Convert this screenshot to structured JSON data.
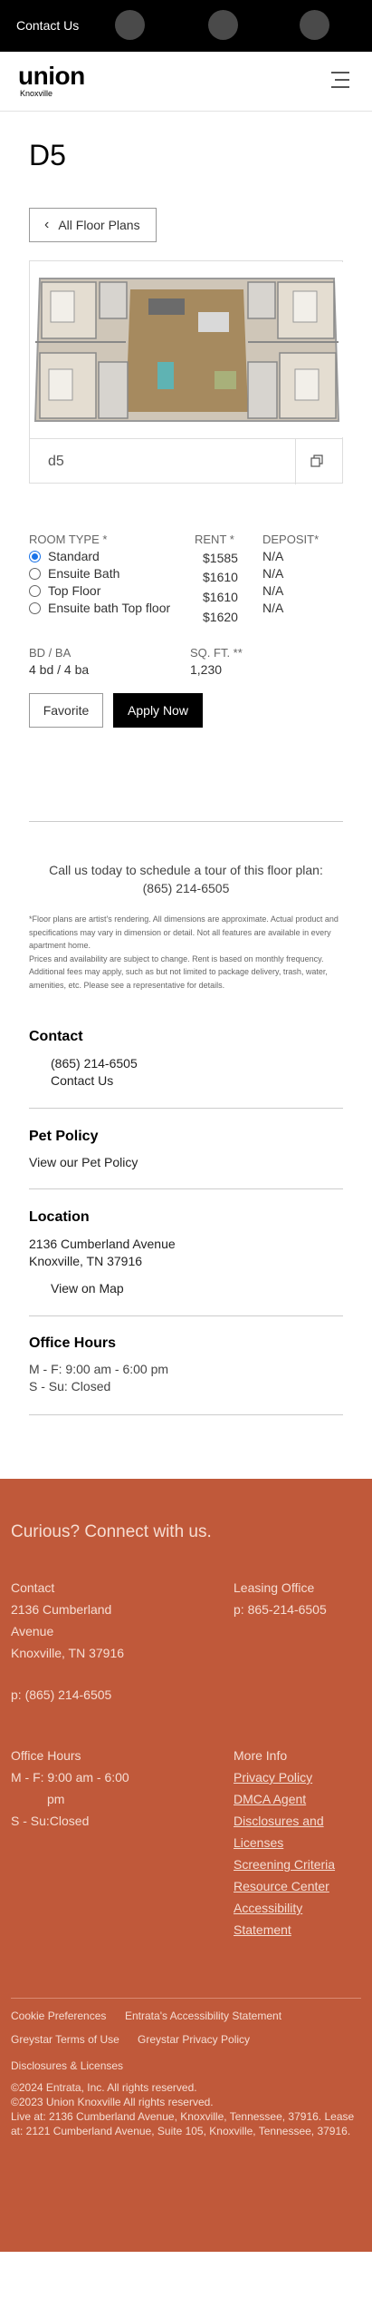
{
  "topbar": {
    "contact_label": "Contact Us"
  },
  "brand": {
    "logo": "union",
    "sub": "Knoxville"
  },
  "plan": {
    "title": "D5",
    "back_label": "All Floor Plans",
    "caption": "d5"
  },
  "details": {
    "headers": {
      "room_type": "ROOM TYPE *",
      "rent": "RENT *",
      "deposit": "DEPOSIT*"
    },
    "rows": [
      {
        "room_type": "Standard",
        "rent": "$1585",
        "deposit": "N/A",
        "selected": true
      },
      {
        "room_type": "Ensuite Bath",
        "rent": "$1610",
        "deposit": "N/A",
        "selected": false
      },
      {
        "room_type": "Top Floor",
        "rent": "$1610",
        "deposit": "N/A",
        "selected": false
      },
      {
        "room_type": "Ensuite bath Top floor",
        "rent": "$1620",
        "deposit": "N/A",
        "selected": false
      }
    ],
    "bdba_label": "BD / BA",
    "bdba_value": "4 bd / 4 ba",
    "sqft_label": "SQ. FT. **",
    "sqft_value": "1,230"
  },
  "actions": {
    "favorite": "Favorite",
    "apply": "Apply Now"
  },
  "schedule": {
    "line1": "Call us today to schedule a tour of this floor plan:",
    "phone": "(865) 214-6505"
  },
  "disclaimer": {
    "p1": "*Floor plans are artist's rendering. All dimensions are approximate. Actual product and specifications may vary in dimension or detail. Not all features are available in every apartment home.",
    "p2": "Prices and availability are subject to change. Rent is based on monthly frequency. Additional fees may apply, such as but not limited to package delivery, trash, water, amenities, etc. Please see a representative for details."
  },
  "contact": {
    "title": "Contact",
    "phone": "(865) 214-6505",
    "link": "Contact Us"
  },
  "pet": {
    "title": "Pet Policy",
    "link": "View our Pet Policy"
  },
  "location": {
    "title": "Location",
    "street": "2136 Cumberland Avenue",
    "city": "Knoxville, TN 37916",
    "map_link": "View on Map"
  },
  "hours": {
    "title": "Office Hours",
    "weekday": "M - F:  9:00 am - 6:00 pm",
    "weekend": "S - Su:  Closed"
  },
  "footer": {
    "headline": "Curious? Connect with us.",
    "contact_title": "Contact",
    "contact_street1": "2136 Cumberland",
    "contact_street2": "Avenue",
    "contact_city": "Knoxville, TN 37916",
    "contact_phone": "p: (865) 214-6505",
    "leasing_title": "Leasing Office",
    "leasing_phone": "p: 865-214-6505",
    "hours_title": "Office Hours",
    "hours_weekday1": "M - F: 9:00 am - 6:00",
    "hours_weekday2": "pm",
    "hours_weekend": "S - Su:Closed",
    "more_title": "More Info",
    "links": [
      "Privacy Policy",
      "DMCA Agent",
      "Disclosures and",
      "Licenses",
      "Screening Criteria",
      "Resource Center",
      "Accessibility",
      "Statement"
    ],
    "cookie": "Cookie Preferences",
    "entrata_access": "Entrata's Accessibility Statement",
    "greystar_terms": "Greystar Terms of Use",
    "greystar_privacy": "Greystar Privacy Policy",
    "disclosures": "Disclosures & Licenses",
    "copy1": "©2024 Entrata, Inc. All rights reserved.",
    "copy2": "©2023 Union Knoxville All rights reserved.",
    "copy3": "Live at: 2136 Cumberland Avenue, Knoxville, Tennessee, 37916. Lease at: 2121 Cumberland Avenue, Suite 105, Knoxville, Tennessee, 37916."
  },
  "colors": {
    "footer_bg": "#c0593a",
    "topbar_bg": "#000000",
    "apply_bg": "#000000"
  }
}
